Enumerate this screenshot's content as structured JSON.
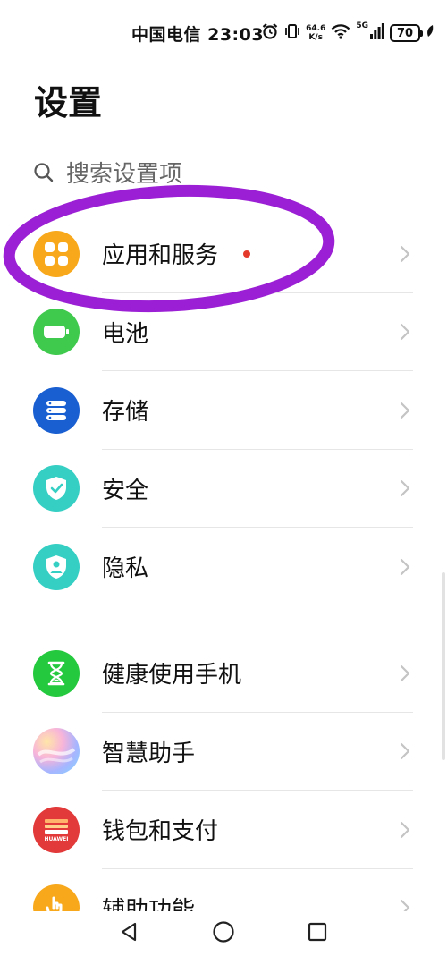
{
  "status_bar": {
    "carrier_time": "中国电信 23:03",
    "net_speed_value": "64.6",
    "net_speed_unit": "K/s",
    "network_gen": "5G",
    "battery_level": "70"
  },
  "page": {
    "title": "设置"
  },
  "search": {
    "placeholder": "搜索设置项"
  },
  "group1": [
    {
      "label": "应用和服务",
      "icon": "apps-icon",
      "color": "#f7a81b",
      "has_red_dot": true
    },
    {
      "label": "电池",
      "icon": "battery-icon",
      "color": "#3fc94d"
    },
    {
      "label": "存储",
      "icon": "storage-icon",
      "color": "#1a5fd1"
    },
    {
      "label": "安全",
      "icon": "shield-check-icon",
      "color": "#36cfc4"
    },
    {
      "label": "隐私",
      "icon": "privacy-shield-icon",
      "color": "#36cfc4"
    }
  ],
  "group2": [
    {
      "label": "健康使用手机",
      "icon": "hourglass-icon",
      "color": "#25c93e"
    },
    {
      "label": "智慧助手",
      "icon": "assistant-icon",
      "color": "gradient"
    },
    {
      "label": "钱包和支付",
      "icon": "wallet-icon",
      "color": "#e23a3a",
      "icon_text": "HUAWEI"
    },
    {
      "label": "辅助功能",
      "icon": "accessibility-hand-icon",
      "color": "#f7a81b"
    }
  ],
  "annotation_color": "#9b1fd4"
}
